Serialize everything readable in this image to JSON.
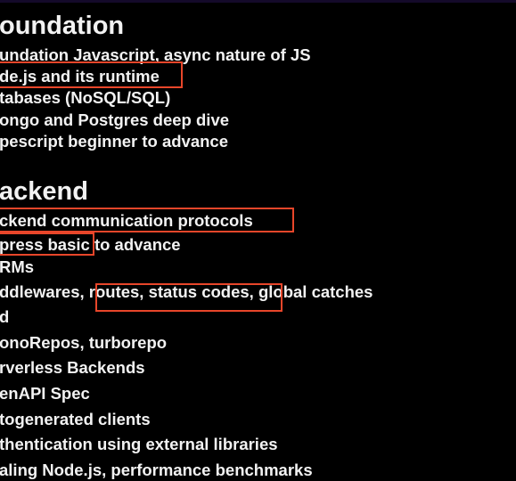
{
  "slide": {
    "sections": [
      {
        "heading": "oundation",
        "items": [
          "undation Javascript, async nature of JS",
          "de.js and its runtime",
          "tabases (NoSQL/SQL)",
          "ongo and Postgres deep dive",
          "pescript beginner to advance"
        ]
      },
      {
        "heading": "ackend",
        "items": [
          "ckend communication protocols",
          "press basic to advance",
          "RMs",
          "ddlewares, routes, status codes, global catches",
          "d",
          "onoRepos, turborepo",
          "rverless Backends",
          "enAPI Spec",
          "togenerated clients",
          "thentication using external libraries",
          "aling Node.js, performance benchmarks"
        ]
      }
    ],
    "highlight_color": "#e8462a"
  }
}
